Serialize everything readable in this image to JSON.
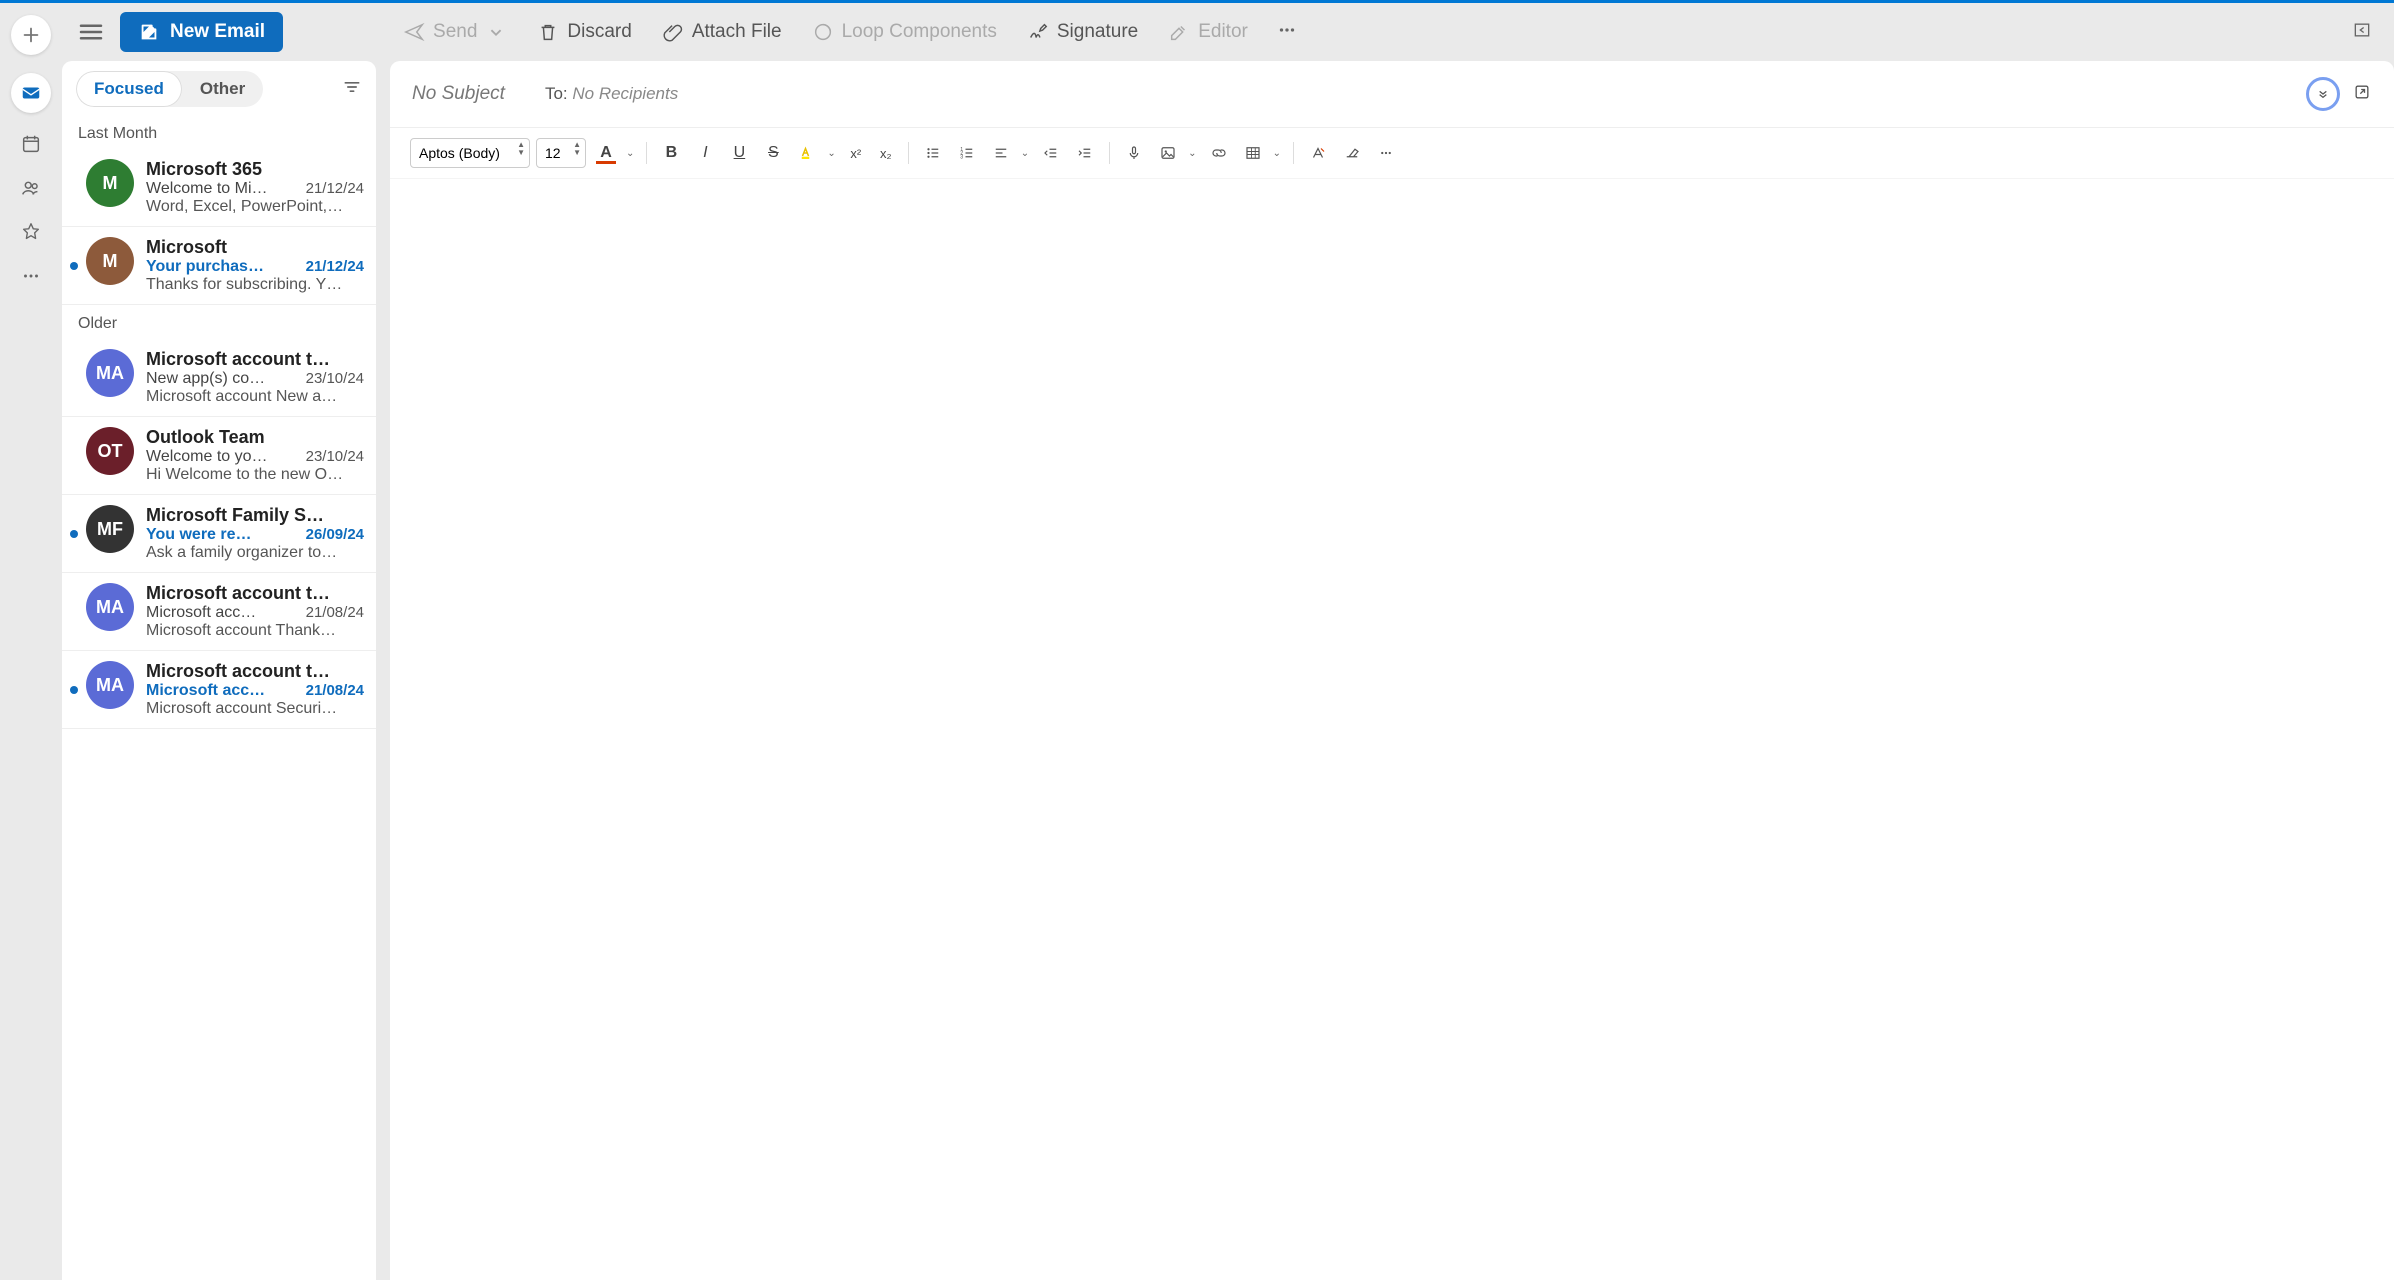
{
  "ribbon": {
    "new_email": "New Email",
    "send": "Send",
    "discard": "Discard",
    "attach": "Attach File",
    "loop": "Loop Components",
    "signature": "Signature",
    "editor": "Editor"
  },
  "tabs": {
    "focused": "Focused",
    "other": "Other"
  },
  "groups": {
    "last_month": "Last Month",
    "older": "Older"
  },
  "emails": [
    {
      "sender": "Microsoft 365",
      "subject": "Welcome to Mi…",
      "date": "21/12/24",
      "preview": "Word, Excel, PowerPoint,…",
      "avatar": "M",
      "color": "#2e7d32",
      "unread": false
    },
    {
      "sender": "Microsoft",
      "subject": "Your purchas…",
      "date": "21/12/24",
      "preview": "Thanks for subscribing. Y…",
      "avatar": "M",
      "color": "#8d5a3b",
      "unread": true
    },
    {
      "sender": "Microsoft account t…",
      "subject": "New app(s) co…",
      "date": "23/10/24",
      "preview": "Microsoft account New a…",
      "avatar": "MA",
      "color": "#5b6bd6",
      "unread": false
    },
    {
      "sender": "Outlook Team",
      "subject": "Welcome to yo…",
      "date": "23/10/24",
      "preview": "Hi Welcome to the new O…",
      "avatar": "OT",
      "color": "#6b1f2a",
      "unread": false
    },
    {
      "sender": "Microsoft Family S…",
      "subject": "You were re…",
      "date": "26/09/24",
      "preview": "Ask a family organizer to…",
      "avatar": "MF",
      "color": "#333",
      "unread": true
    },
    {
      "sender": "Microsoft account t…",
      "subject": "Microsoft acc…",
      "date": "21/08/24",
      "preview": "Microsoft account Thank…",
      "avatar": "MA",
      "color": "#5b6bd6",
      "unread": false
    },
    {
      "sender": "Microsoft account t…",
      "subject": "Microsoft acc…",
      "date": "21/08/24",
      "preview": "Microsoft account Securi…",
      "avatar": "MA",
      "color": "#5b6bd6",
      "unread": true
    }
  ],
  "compose": {
    "subject_placeholder": "No Subject",
    "to_label": "To:",
    "to_placeholder": "No Recipients",
    "font_name": "Aptos (Body)",
    "font_size": "12"
  }
}
